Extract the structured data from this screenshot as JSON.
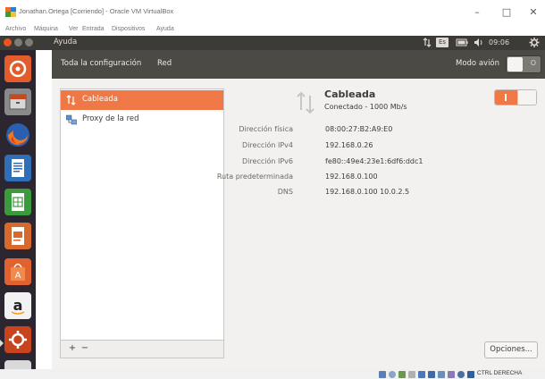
{
  "host": {
    "title": "Jonathan.Ortega [Corriendo] - Oracle VM VirtualBox",
    "menu": [
      "Archivo",
      "Máquina",
      "Ver",
      "Entrada",
      "Dispositivos",
      "Ayuda"
    ],
    "window_controls": {
      "minimize": "–",
      "maximize": "□",
      "close": "✕"
    },
    "status_text": "CTRL DERECHA"
  },
  "panel": {
    "app_name": "Ayuda",
    "keyboard": "Es",
    "clock": "09:06"
  },
  "header": {
    "back_label": "Toda la configuración",
    "section_label": "Red",
    "airplane_label": "Modo avión",
    "airplane_state": "O"
  },
  "devices": [
    {
      "label": "Cableada"
    },
    {
      "label": "Proxy de la red"
    }
  ],
  "list_toolbar": {
    "add": "+",
    "remove": "−"
  },
  "connection": {
    "name": "Cableada",
    "status": "Conectado - 1000 Mb/s"
  },
  "details": [
    {
      "key": "Dirección física",
      "value": "08:00:27:B2:A9:E0"
    },
    {
      "key": "Dirección IPv4",
      "value": "192.168.0.26"
    },
    {
      "key": "Dirección IPv6",
      "value": "fe80::49e4:23e1:6df6:ddc1"
    },
    {
      "key": "Ruta predeterminada",
      "value": "192.168.0.100"
    },
    {
      "key": "DNS",
      "value": "192.168.0.100 10.0.2.5"
    }
  ],
  "options_label": "Opciones...",
  "colors": {
    "accent": "#f07746",
    "panel": "#3c3b37",
    "launcher": "#2b2630",
    "header": "#4b4a45"
  }
}
